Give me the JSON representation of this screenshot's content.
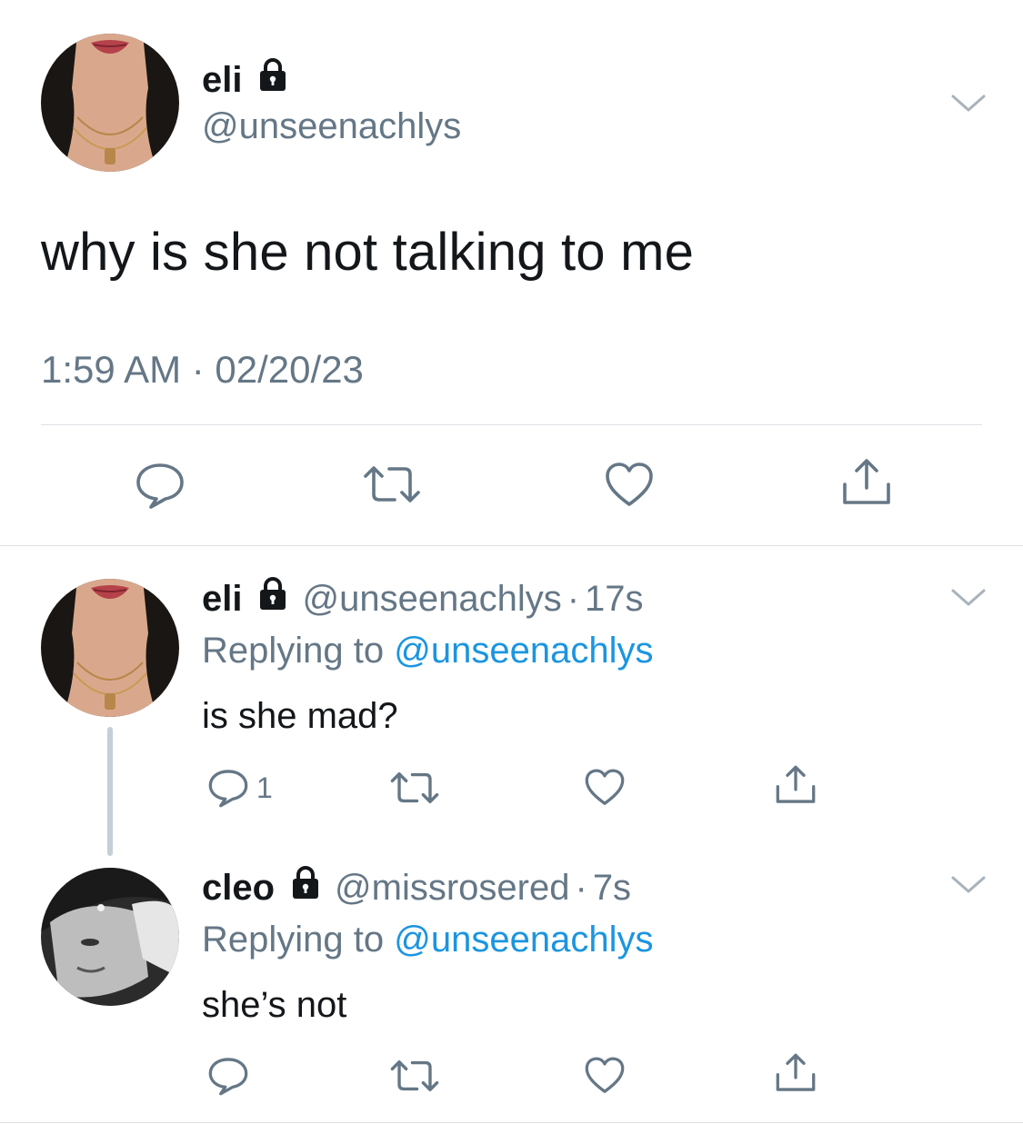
{
  "main_tweet": {
    "author_name": "eli",
    "author_handle": "@unseenachlys",
    "text": "why is she not talking to me",
    "timestamp": "1:59 AM · 02/20/23",
    "locked": true
  },
  "replies": [
    {
      "author_name": "eli",
      "author_handle": "@unseenachlys",
      "separator": "·",
      "time": "17s",
      "replying_prefix": "Replying to ",
      "replying_to": "@unseenachlys",
      "text": "is she mad?",
      "reply_count": "1",
      "locked": true
    },
    {
      "author_name": "cleo",
      "author_handle": "@missrosered",
      "separator": "·",
      "time": "7s",
      "replying_prefix": "Replying to ",
      "replying_to": "@unseenachlys",
      "text": "she’s not",
      "reply_count": "",
      "locked": true
    }
  ],
  "icons": {
    "reply": "speech-bubble-icon",
    "retweet": "retweet-icon",
    "like": "heart-icon",
    "share": "share-icon",
    "more": "chevron-down-icon",
    "protected": "lock-icon"
  },
  "colors": {
    "text": "#14171a",
    "secondary": "#657786",
    "link": "#1b95e0",
    "divider": "#dcdfe3",
    "thread_line": "#c4cfd6"
  }
}
